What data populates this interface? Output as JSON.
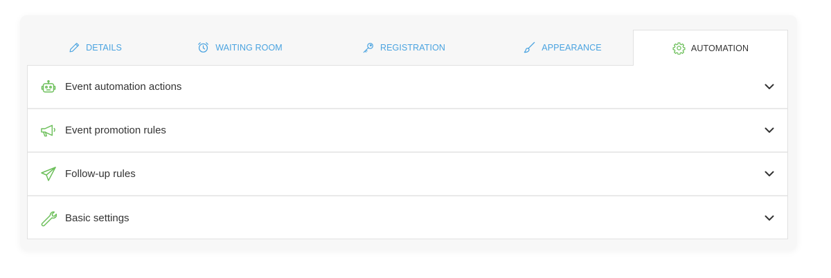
{
  "tabs": [
    {
      "label": "DETAILS",
      "icon": "pencil-icon",
      "active": false
    },
    {
      "label": "WAITING ROOM",
      "icon": "alarm-clock-icon",
      "active": false
    },
    {
      "label": "REGISTRATION",
      "icon": "key-icon",
      "active": false
    },
    {
      "label": "APPEARANCE",
      "icon": "brush-icon",
      "active": false
    },
    {
      "label": "AUTOMATION",
      "icon": "gear-icon",
      "active": true
    }
  ],
  "sections": [
    {
      "label": "Event automation actions",
      "icon": "robot-icon"
    },
    {
      "label": "Event promotion rules",
      "icon": "megaphone-icon"
    },
    {
      "label": "Follow-up rules",
      "icon": "paper-plane-icon"
    },
    {
      "label": "Basic settings",
      "icon": "wrench-icon"
    }
  ],
  "colors": {
    "tab_text": "#4aa3e0",
    "active_text": "#333333",
    "section_icon": "#6cbf5a"
  }
}
